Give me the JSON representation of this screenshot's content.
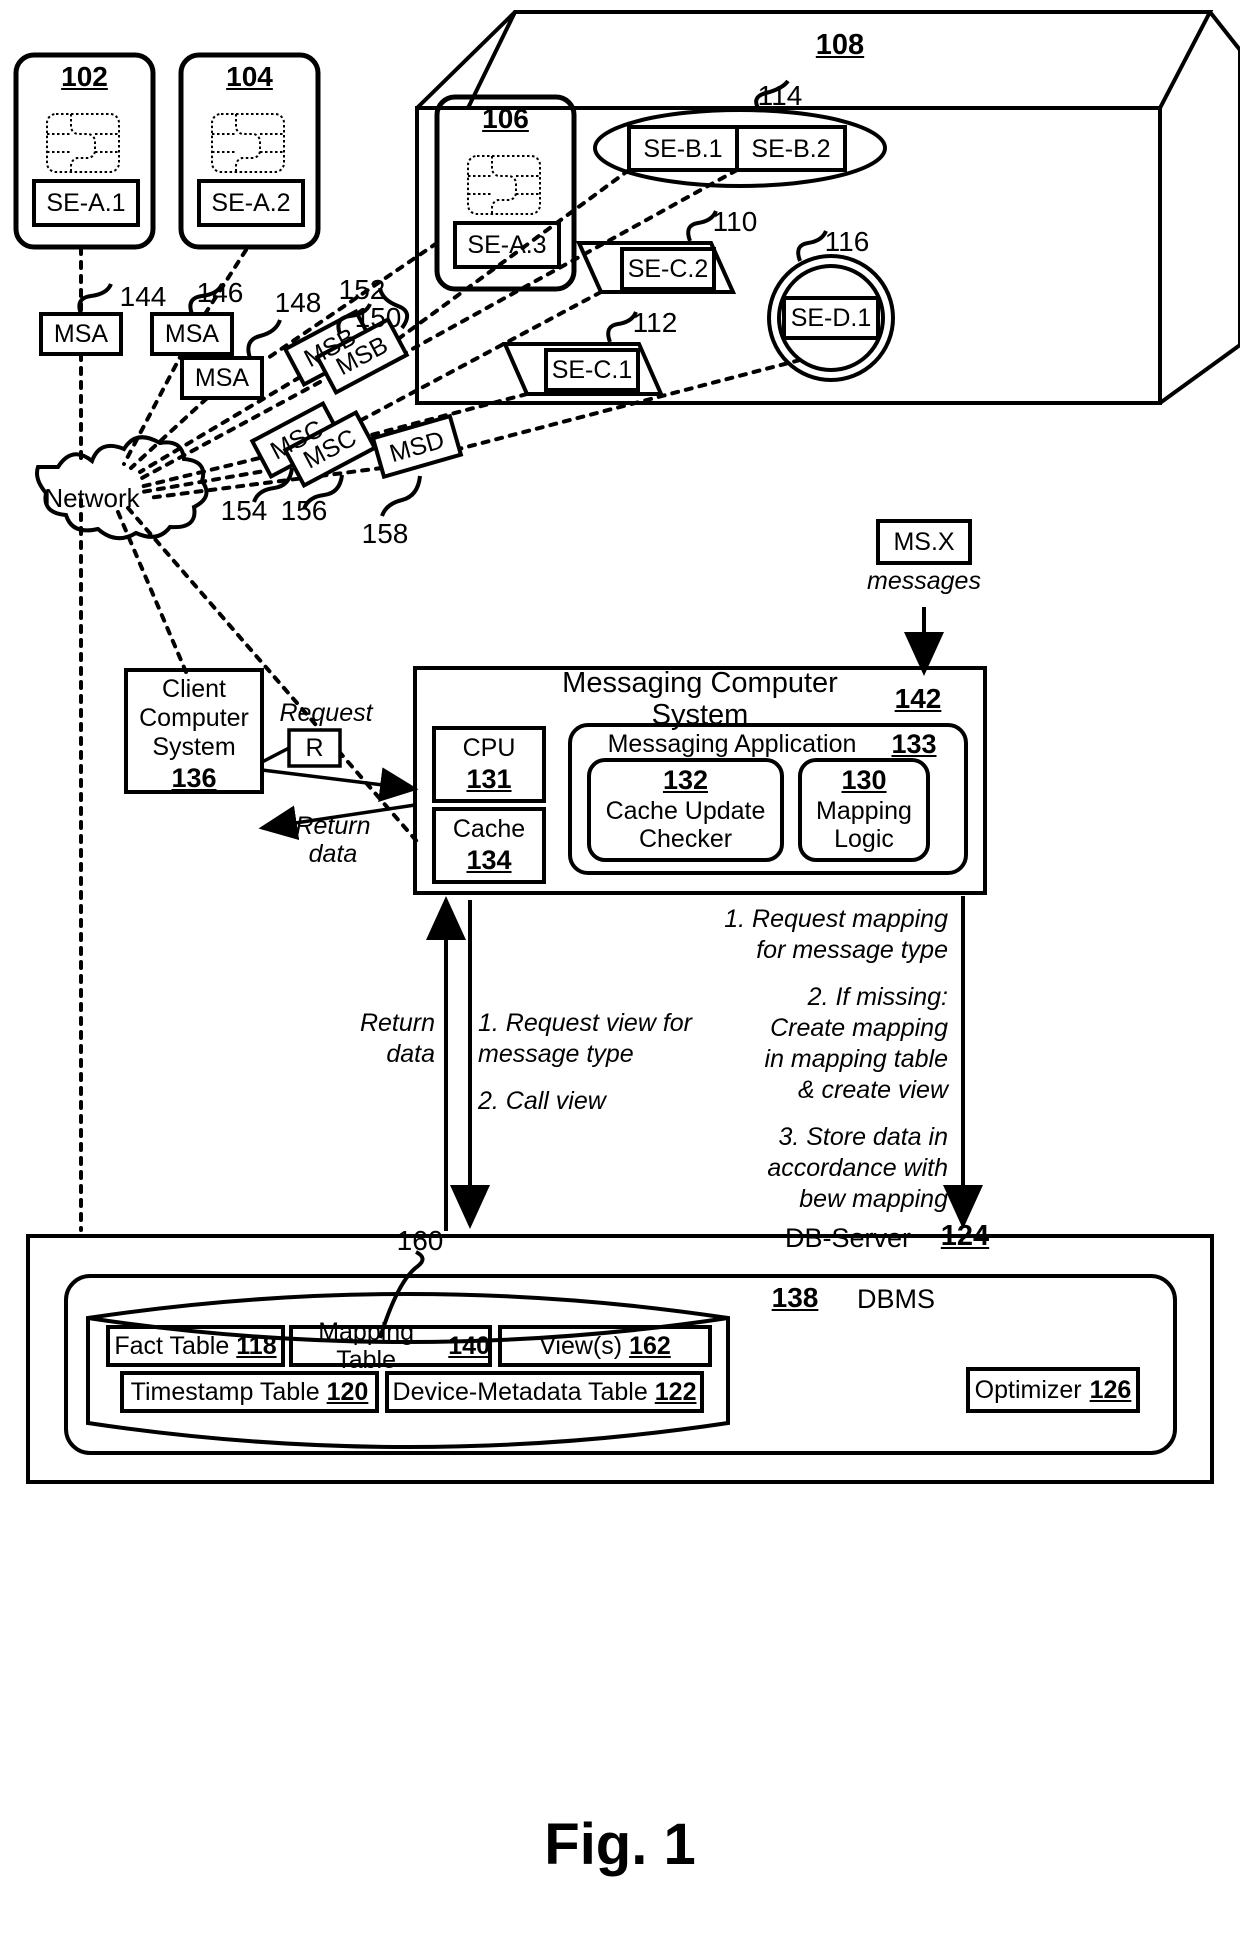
{
  "figure": {
    "caption": "Fig. 1"
  },
  "devices": {
    "card_a": {
      "ref": "102",
      "se_label": "SE-A.1",
      "icon": "sim-chip-icon"
    },
    "card_b": {
      "ref": "104",
      "se_label": "SE-A.2",
      "icon": "sim-chip-icon"
    },
    "card_c": {
      "ref": "106",
      "se_label": "SE-A.3",
      "icon": "sim-chip-icon"
    }
  },
  "enclosure": {
    "ref": "108",
    "elements": [
      {
        "ref": "114",
        "shape": "ellipse",
        "cells": [
          "SE-B.1",
          "SE-B.2"
        ]
      },
      {
        "ref": "110",
        "shape": "parallelogram",
        "label": "SE-C.2"
      },
      {
        "ref": "112",
        "shape": "parallelogram",
        "label": "SE-C.1"
      },
      {
        "ref": "116",
        "shape": "circle",
        "label": "SE-D.1"
      }
    ]
  },
  "messages": [
    {
      "ref": "144",
      "label": "MSA"
    },
    {
      "ref": "146",
      "label": "MSA"
    },
    {
      "ref": "148",
      "label": "MSA"
    },
    {
      "ref": "150",
      "label": "MSB"
    },
    {
      "ref": "152",
      "label": "MSB"
    },
    {
      "ref": "154",
      "label": "MSC"
    },
    {
      "ref": "156",
      "label": "MSC"
    },
    {
      "ref": "158",
      "label": "MSD"
    }
  ],
  "network": {
    "label": "Network"
  },
  "msx": {
    "label": "MS.X",
    "sub": "messages"
  },
  "client": {
    "line1": "Client",
    "line2": "Computer",
    "line3": "System",
    "ref": "136"
  },
  "request": {
    "caption": "Request",
    "box": "R"
  },
  "return_left": {
    "line1": "Return",
    "line2": "data"
  },
  "mcs": {
    "title": "Messaging Computer System",
    "ref": "142",
    "cpu": {
      "label": "CPU",
      "ref": "131"
    },
    "cache": {
      "label": "Cache",
      "ref": "134"
    },
    "app": {
      "title": "Messaging Application",
      "ref": "133",
      "modules": [
        {
          "ref": "132",
          "line1": "Cache Update",
          "line2": "Checker"
        },
        {
          "ref": "130",
          "line1": "Mapping",
          "line2": "Logic"
        }
      ]
    }
  },
  "flows": {
    "return_data": {
      "line1": "Return",
      "line2": "data"
    },
    "db_steps_left": [
      "1. Request view for",
      "message type",
      "2. Call view"
    ],
    "db_steps_right": [
      "1. Request mapping",
      "for message type",
      "2. If missing:",
      "Create mapping",
      "in mapping table",
      "& create view",
      "3. Store data in",
      "accordance with",
      "bew mapping"
    ]
  },
  "dbserver": {
    "title": "DB-Server",
    "ref": "124",
    "dbms_ref": "138",
    "dbms_label": "DBMS",
    "cylinder_ref": "160",
    "tables_row1": [
      {
        "label": "Fact Table",
        "ref": "118"
      },
      {
        "label": "Mapping Table",
        "ref": "140"
      },
      {
        "label": "View(s)",
        "ref": "162"
      }
    ],
    "tables_row2": [
      {
        "label": "Timestamp Table",
        "ref": "120"
      },
      {
        "label": "Device-Metadata Table",
        "ref": "122"
      }
    ],
    "optimizer": {
      "label": "Optimizer",
      "ref": "126"
    }
  }
}
